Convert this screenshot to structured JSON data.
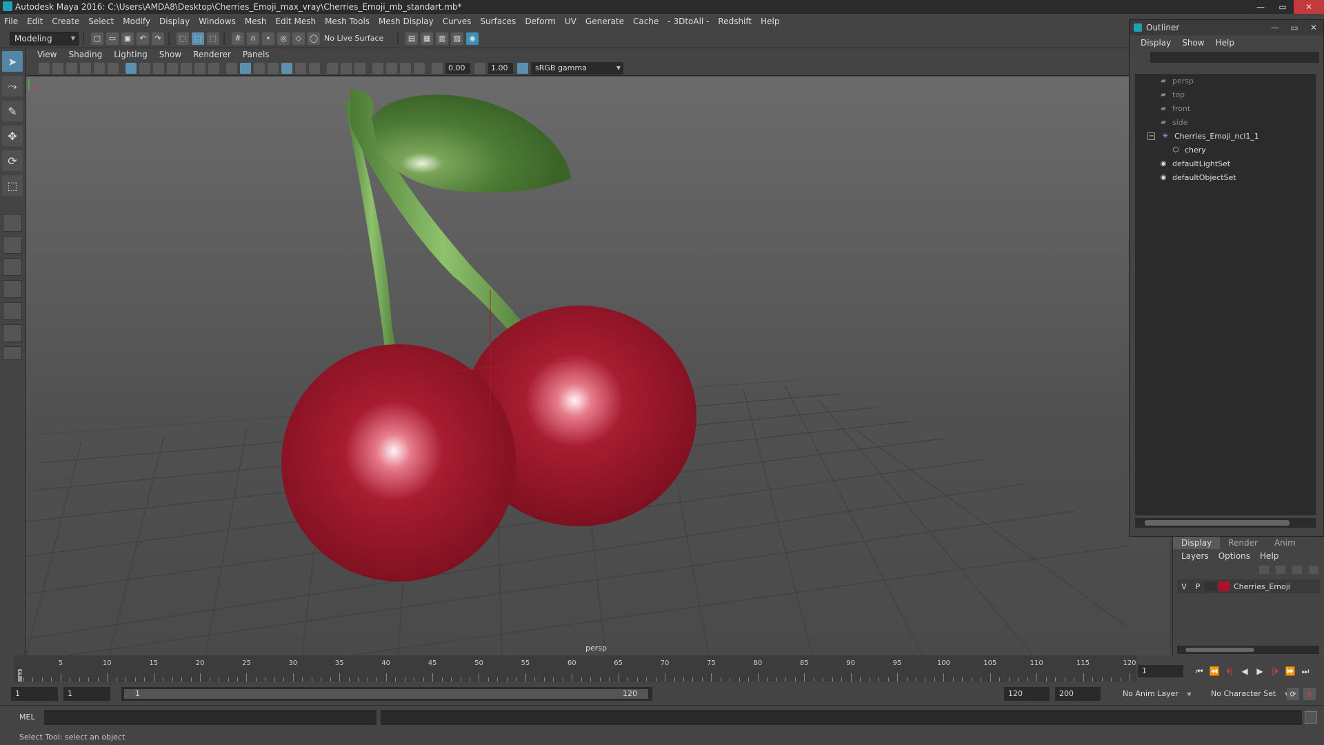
{
  "window": {
    "title": "Autodesk Maya 2016: C:\\Users\\AMDA8\\Desktop\\Cherries_Emoji_max_vray\\Cherries_Emoji_mb_standart.mb*",
    "controls": [
      "—",
      "▭",
      "✕"
    ]
  },
  "menubar": [
    "File",
    "Edit",
    "Create",
    "Select",
    "Modify",
    "Display",
    "Windows",
    "Mesh",
    "Edit Mesh",
    "Mesh Tools",
    "Mesh Display",
    "Curves",
    "Surfaces",
    "Deform",
    "UV",
    "Generate",
    "Cache",
    "- 3DtoAll -",
    "Redshift",
    "Help"
  ],
  "shelf": {
    "mode": "Modeling",
    "live_surface": "No Live Surface"
  },
  "panel": {
    "menu": [
      "View",
      "Shading",
      "Lighting",
      "Show",
      "Renderer",
      "Panels"
    ],
    "exposure": "0.00",
    "gamma_value": "1.00",
    "color_space": "sRGB gamma",
    "camera": "persp"
  },
  "outliner": {
    "title": "Outliner",
    "menu": [
      "Display",
      "Show",
      "Help"
    ],
    "items": [
      {
        "label": "persp",
        "type": "camera",
        "dim": true
      },
      {
        "label": "top",
        "type": "camera",
        "dim": true
      },
      {
        "label": "front",
        "type": "camera",
        "dim": true
      },
      {
        "label": "side",
        "type": "camera",
        "dim": true
      },
      {
        "label": "Cherries_Emoji_ncl1_1",
        "type": "group",
        "dim": false
      },
      {
        "label": "chery",
        "type": "mesh",
        "dim": false
      },
      {
        "label": "defaultLightSet",
        "type": "set",
        "dim": false
      },
      {
        "label": "defaultObjectSet",
        "type": "set",
        "dim": false
      }
    ]
  },
  "layers": {
    "tabs": [
      "Display",
      "Render",
      "Anim"
    ],
    "menu": [
      "Layers",
      "Options",
      "Help"
    ],
    "layer": {
      "v": "V",
      "p": "P",
      "name": "Cherries_Emoji",
      "color": "#b0102a"
    }
  },
  "timeline": {
    "labels": [
      "5",
      "10",
      "15",
      "20",
      "25",
      "30",
      "35",
      "40",
      "45",
      "50",
      "55",
      "60",
      "65",
      "70",
      "75",
      "80",
      "85",
      "90",
      "95",
      "100",
      "105",
      "110",
      "115",
      "120"
    ],
    "current": "1",
    "current_field": "1",
    "playback": [
      "⏮",
      "⏪",
      "⏴|",
      "◀",
      "▶",
      "|⏵",
      "⏩",
      "⏭"
    ]
  },
  "range": {
    "start": "1",
    "playback_start": "1",
    "slider_start": "1",
    "slider_end": "120",
    "playback_end": "120",
    "end": "200",
    "anim_layer": "No Anim Layer",
    "character_set": "No Character Set"
  },
  "command": {
    "label": "MEL"
  },
  "help_line": "Select Tool: select an object"
}
